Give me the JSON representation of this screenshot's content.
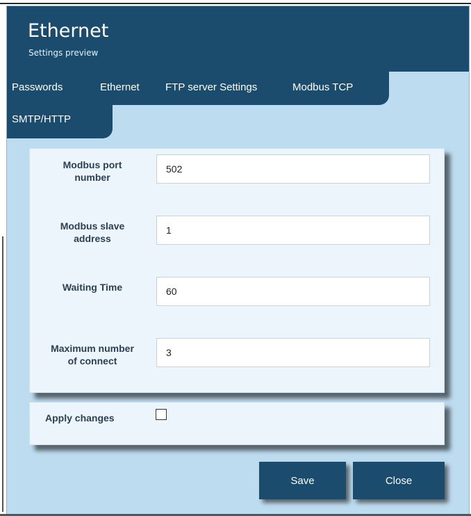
{
  "header": {
    "title": "Ethernet",
    "subtitle": "Settings preview"
  },
  "tabs": [
    {
      "label": "Passwords"
    },
    {
      "label": "Ethernet"
    },
    {
      "label": "FTP server Settings"
    },
    {
      "label": "Modbus TCP"
    },
    {
      "label": "SMTP/HTTP"
    }
  ],
  "form": {
    "fields": [
      {
        "label_line1": "Modbus port",
        "label_line2": "number",
        "value": "502"
      },
      {
        "label_line1": "Modbus slave",
        "label_line2": "address",
        "value": "1"
      },
      {
        "label_line1": "Waiting Time",
        "label_line2": "",
        "value": "60"
      },
      {
        "label_line1": "Maximum number",
        "label_line2": "of connect",
        "value": "3"
      }
    ]
  },
  "apply": {
    "label": "Apply changes",
    "checked": false
  },
  "buttons": {
    "save": "Save",
    "close": "Close"
  },
  "colors": {
    "header_bg": "#1b4c6e",
    "frame_bg": "#bedcf0",
    "panel_bg": "#ebf5fb",
    "label_text": "#2b3f55"
  }
}
